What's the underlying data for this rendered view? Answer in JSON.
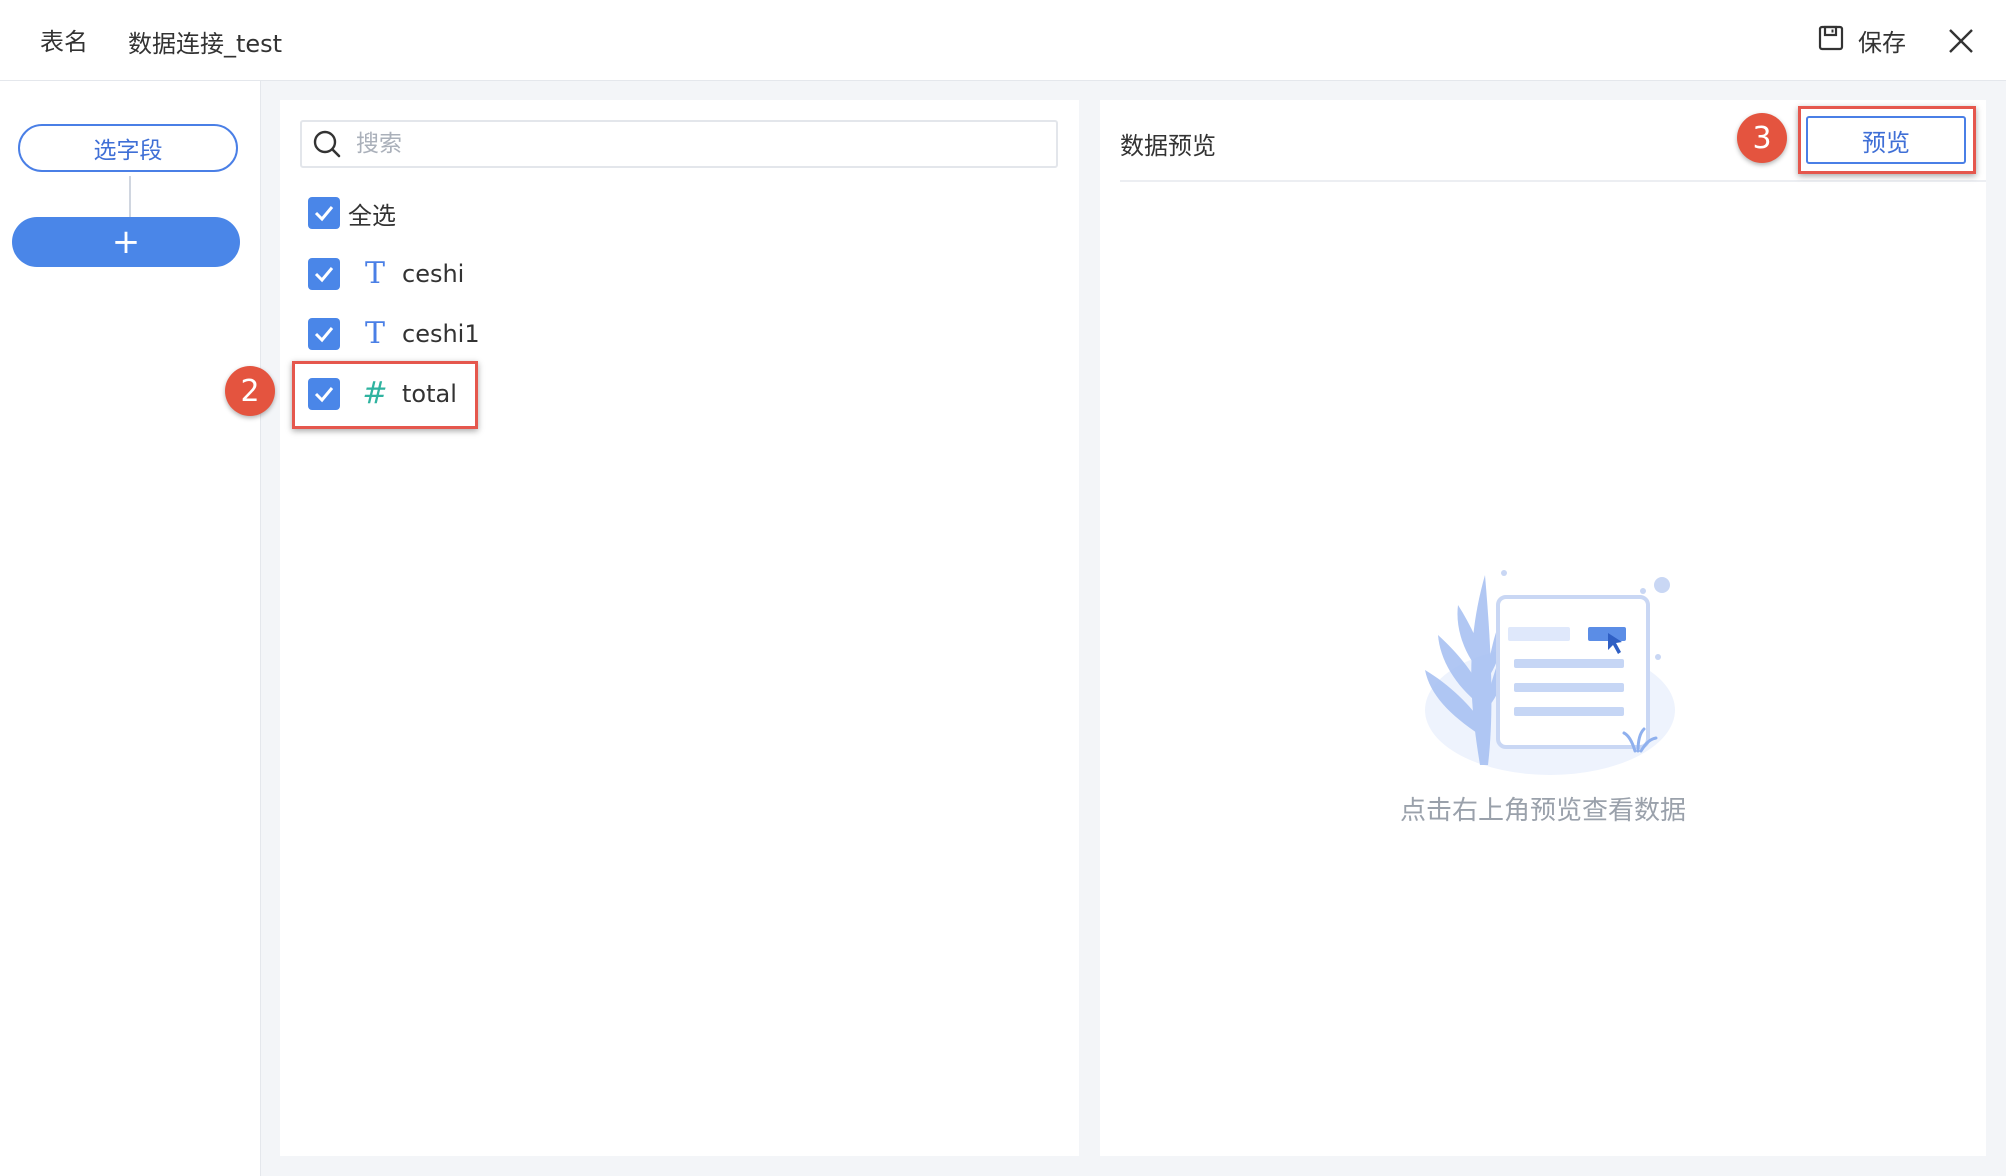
{
  "header": {
    "table_name_label": "表名",
    "table_name_value": "数据连接_test",
    "save_label": "保存"
  },
  "steps": {
    "current_label": "选字段",
    "add_label": "+"
  },
  "fields": {
    "search_placeholder": "搜索",
    "select_all_label": "全选",
    "items": [
      {
        "name": "ceshi",
        "type_glyph": "T",
        "type": "text",
        "checked": true
      },
      {
        "name": "ceshi1",
        "type_glyph": "T",
        "type": "text",
        "checked": true
      },
      {
        "name": "total",
        "type_glyph": "#",
        "type": "number",
        "checked": true
      }
    ]
  },
  "preview": {
    "title": "数据预览",
    "button_label": "预览",
    "empty_text": "点击右上角预览查看数据"
  },
  "annotations": {
    "badge_fields": "2",
    "badge_preview": "3"
  },
  "colors": {
    "accent": "#4a86e8",
    "number_type": "#2fb3a0",
    "highlight": "#e5574d"
  }
}
